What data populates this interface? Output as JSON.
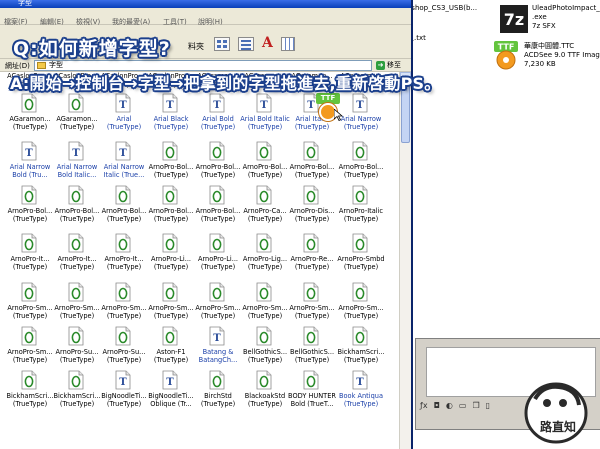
{
  "overlay": {
    "question": "Q:如何新增字型?",
    "answer": "A:開始→控制台→字型→把拿到的字型拖進去,重新啓動PS。"
  },
  "window": {
    "title": "字型",
    "menus": [
      "檔案(F)",
      "編輯(E)",
      "檢視(V)",
      "我的最愛(A)",
      "工具(T)",
      "說明(H)"
    ],
    "toolbar_label": "料夾",
    "address_label": "網址(D)",
    "address_value": "字型",
    "go_label": "移至"
  },
  "background_window": {
    "items": [
      {
        "label": "otoshop_CS3_USB(b..."
      },
      {
        "lines": [
          "UleadPhotoImpact_10(b...",
          ".exe",
          "7z SFX"
        ]
      },
      {
        "label": "人員.txt"
      },
      {
        "lines": [
          "華康中圓體.TTC",
          "ACDSee 9.0 TTF Image",
          "7,230 KB"
        ]
      }
    ],
    "icon_7z_text": "7z",
    "icon_ttf_text": "TTF"
  },
  "drag_badge": "TTF",
  "watermark_text": "路直知",
  "fonts": [
    [
      "ACaslonPro-...",
      "(TrueType)"
    ],
    [
      "ACaslonPro-...",
      "(TrueType)"
    ],
    [
      "ACaslonPro-...",
      "(TrueType)"
    ],
    [
      "ACaslonPro-...",
      "(TrueType)"
    ],
    [
      "AGaramon...",
      "(TrueType)"
    ],
    [
      "AGaramon...",
      "(TrueType)"
    ],
    [
      "AGaramon...",
      "(TrueType)"
    ],
    [
      "AGaramon...",
      "(TrueType)"
    ],
    [
      "AGaramon...",
      "(TrueType)"
    ],
    [
      "AGaramon...",
      "(TrueType)"
    ],
    [
      "Arial",
      "(TrueType)"
    ],
    [
      "Arial Black",
      "(TrueType)"
    ],
    [
      "Arial Bold",
      "(TrueType)"
    ],
    [
      "Arial Bold Italic",
      "(TrueType)"
    ],
    [
      "Arial Italic",
      "(TrueType)"
    ],
    [
      "Arial Narrow",
      "(TrueType)"
    ],
    [
      "Arial Narrow",
      "Bold (Tru..."
    ],
    [
      "Arial Narrow",
      "Bold Italic..."
    ],
    [
      "Arial Narrow",
      "Italic (True..."
    ],
    [
      "ArnoPro-Bol...",
      "(TrueType)"
    ],
    [
      "ArnoPro-Bol...",
      "(TrueType)"
    ],
    [
      "ArnoPro-Bol...",
      "(TrueType)"
    ],
    [
      "ArnoPro-Bol...",
      "(TrueType)"
    ],
    [
      "ArnoPro-Bol...",
      "(TrueType)"
    ],
    [
      "ArnoPro-Bol...",
      "(TrueType)"
    ],
    [
      "ArnoPro-Bol...",
      "(TrueType)"
    ],
    [
      "ArnoPro-Bol...",
      "(TrueType)"
    ],
    [
      "ArnoPro-Bol...",
      "(TrueType)"
    ],
    [
      "ArnoPro-Bol...",
      "(TrueType)"
    ],
    [
      "ArnoPro-Ca...",
      "(TrueType)"
    ],
    [
      "ArnoPro-Dis...",
      "(TrueType)"
    ],
    [
      "ArnoPro-Italic",
      "(TrueType)"
    ],
    [
      "ArnoPro-It...",
      "(TrueType)"
    ],
    [
      "ArnoPro-It...",
      "(TrueType)"
    ],
    [
      "ArnoPro-It...",
      "(TrueType)"
    ],
    [
      "ArnoPro-Li...",
      "(TrueType)"
    ],
    [
      "ArnoPro-Li...",
      "(TrueType)"
    ],
    [
      "ArnoPro-Lig...",
      "(TrueType)"
    ],
    [
      "ArnoPro-Re...",
      "(TrueType)"
    ],
    [
      "ArnoPro-Smbd",
      "(TrueType)"
    ],
    [
      "ArnoPro-Sm...",
      "(TrueType)"
    ],
    [
      "ArnoPro-Sm...",
      "(TrueType)"
    ],
    [
      "ArnoPro-Sm...",
      "(TrueType)"
    ],
    [
      "ArnoPro-Sm...",
      "(TrueType)"
    ],
    [
      "ArnoPro-Sm...",
      "(TrueType)"
    ],
    [
      "ArnoPro-Sm...",
      "(TrueType)"
    ],
    [
      "ArnoPro-Sm...",
      "(TrueType)"
    ],
    [
      "ArnoPro-Sm...",
      "(TrueType)"
    ],
    [
      "ArnoPro-Sm...",
      "(TrueType)"
    ],
    [
      "ArnoPro-Su...",
      "(TrueType)"
    ],
    [
      "ArnoPro-Su...",
      "(TrueType)"
    ],
    [
      "Aston-F1",
      "(TrueType)"
    ],
    [
      "Batang &",
      "BatangCh..."
    ],
    [
      "BellGothicS...",
      "(TrueType)"
    ],
    [
      "BellGothicS...",
      "(TrueType)"
    ],
    [
      "BickhamScri...",
      "(TrueType)"
    ],
    [
      "BickhamScri...",
      "(TrueType)"
    ],
    [
      "BickhamScri...",
      "(TrueType)"
    ],
    [
      "BigNoodleTi...",
      "(TrueType)"
    ],
    [
      "BigNoodleTi...",
      "Oblique (Tr..."
    ],
    [
      "BirchStd",
      "(TrueType)"
    ],
    [
      "BlackoakStd",
      "(TrueType)"
    ],
    [
      "BODY HUNTER",
      "Bold (TrueT..."
    ],
    [
      "Book Antiqua",
      "(TrueType)"
    ]
  ],
  "font_meta": {
    "blue_indices": [
      10,
      11,
      12,
      13,
      14,
      15,
      16,
      17,
      18,
      52,
      63
    ],
    "t_icon_indices": [
      2,
      10,
      11,
      12,
      13,
      14,
      15,
      16,
      17,
      18,
      52,
      58,
      59,
      63
    ]
  }
}
